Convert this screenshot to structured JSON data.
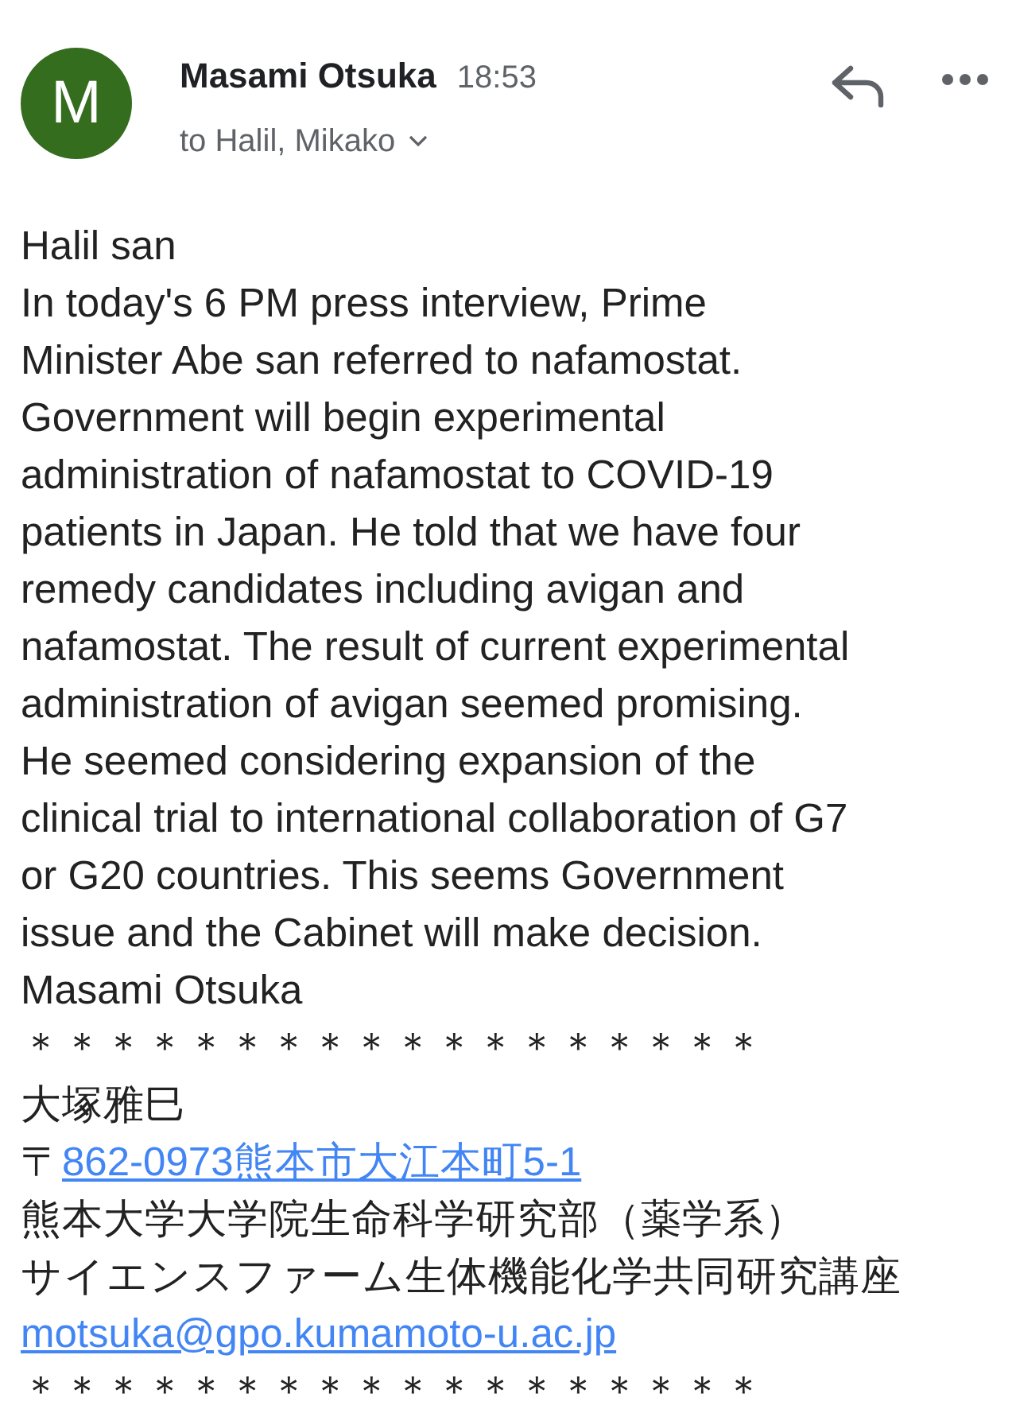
{
  "sender": {
    "initial": "M",
    "name": "Masami Otsuka",
    "time": "18:53",
    "recipients": "to Halil, Mikako"
  },
  "body_lines": [
    {
      "kind": "text",
      "text": "Halil san"
    },
    {
      "kind": "text",
      "text": "In today's 6 PM press interview, Prime"
    },
    {
      "kind": "text",
      "text": "Minister Abe san referred to nafamostat."
    },
    {
      "kind": "text",
      "text": "Government will begin experimental"
    },
    {
      "kind": "text",
      "text": "administration of nafamostat to COVID-19"
    },
    {
      "kind": "text",
      "text": "patients in Japan. He told that we have four"
    },
    {
      "kind": "text",
      "text": "remedy candidates including avigan and"
    },
    {
      "kind": "text",
      "text": "nafamostat. The result of current experimental"
    },
    {
      "kind": "text",
      "text": "administration of avigan seemed promising."
    },
    {
      "kind": "text",
      "text": "He seemed considering expansion of the"
    },
    {
      "kind": "text",
      "text": "clinical trial to international collaboration of G7"
    },
    {
      "kind": "text",
      "text": "or G20 countries. This seems Government"
    },
    {
      "kind": "text",
      "text": "issue and the Cabinet will make decision."
    },
    {
      "kind": "text",
      "text": "Masami Otsuka"
    },
    {
      "kind": "text",
      "text": "＊＊＊＊＊＊＊＊＊＊＊＊＊＊＊＊＊＊"
    },
    {
      "kind": "text",
      "text": "大塚雅巳"
    },
    {
      "kind": "address",
      "prefix": "〒",
      "link": "862-0973熊本市大江本町5-1"
    },
    {
      "kind": "text",
      "text": "熊本大学大学院生命科学研究部（薬学系）"
    },
    {
      "kind": "text",
      "text": "サイエンスファーム生体機能化学共同研究講座"
    },
    {
      "kind": "link",
      "text": "motsuka@gpo.kumamoto-u.ac.jp"
    },
    {
      "kind": "text",
      "text": "＊＊＊＊＊＊＊＊＊＊＊＊＊＊＊＊＊＊"
    }
  ]
}
